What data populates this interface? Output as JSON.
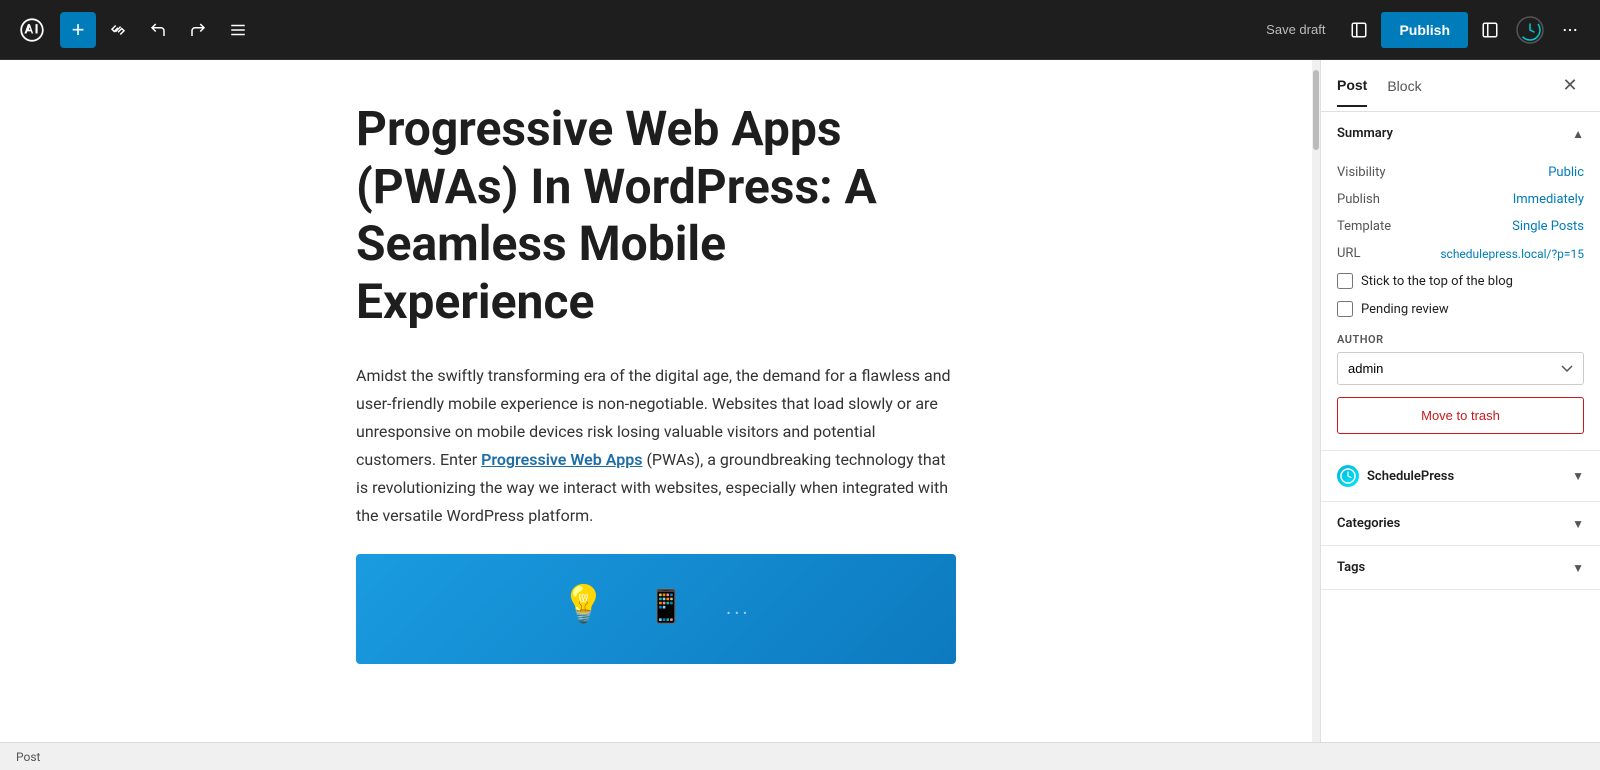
{
  "toolbar": {
    "add_label": "+",
    "save_draft_label": "Save draft",
    "publish_label": "Publish"
  },
  "editor": {
    "title": "Progressive Web Apps (PWAs) In WordPress: A Seamless Mobile Experience",
    "body_text": "Amidst the swiftly transforming era of the digital age, the demand for a flawless and user-friendly mobile experience is non-negotiable. Websites that load slowly or are unresponsive on mobile devices risk losing valuable visitors and potential customers. Enter ",
    "body_link_text": "Progressive Web Apps",
    "body_text2": " (PWAs), a groundbreaking technology that is revolutionizing the way we interact with websites, especially when integrated with the versatile WordPress platform."
  },
  "sidebar": {
    "tab_post_label": "Post",
    "tab_block_label": "Block",
    "summary_title": "Summary",
    "visibility_label": "Visibility",
    "visibility_value": "Public",
    "publish_label": "Publish",
    "publish_value": "Immediately",
    "template_label": "Template",
    "template_value": "Single Posts",
    "url_label": "URL",
    "url_value": "schedulepress.local/?p=15",
    "stick_to_top_label": "Stick to the top of the blog",
    "pending_review_label": "Pending review",
    "author_label": "AUTHOR",
    "author_value": "admin",
    "move_to_trash_label": "Move to trash",
    "schedulepress_title": "SchedulePress",
    "categories_title": "Categories",
    "tags_title": "Tags"
  },
  "footer": {
    "label": "Post"
  }
}
